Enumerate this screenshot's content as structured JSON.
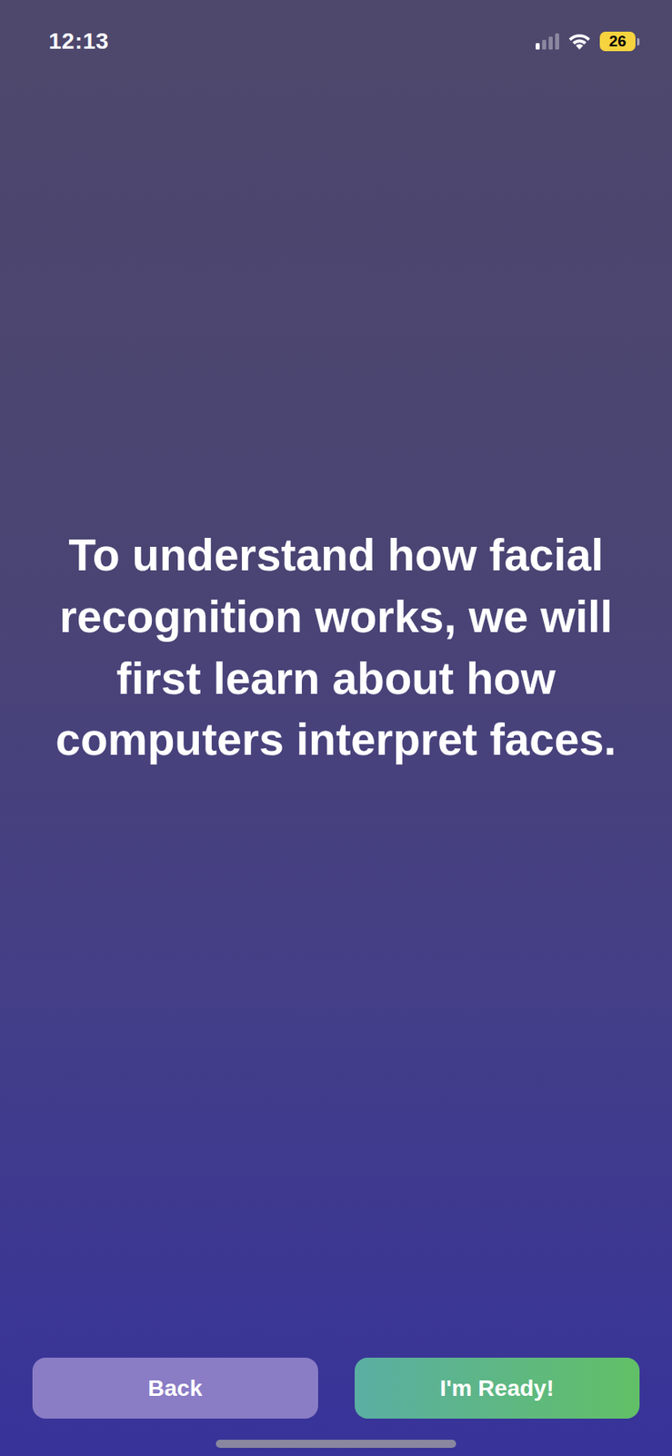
{
  "status_bar": {
    "time": "12:13",
    "battery": "26",
    "low_power": true,
    "signal_level": 0.25,
    "wifi": true
  },
  "message": "To understand how facial recognition works, we will first learn about how computers interpret faces.",
  "buttons": [
    {
      "label": "Back",
      "kind": "secondary"
    },
    {
      "label": "I'm Ready!",
      "kind": "primary"
    }
  ]
}
